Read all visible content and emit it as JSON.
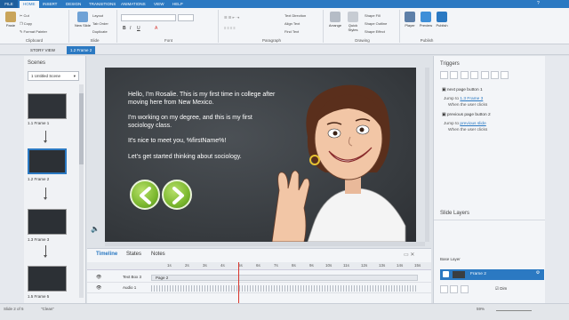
{
  "ribbon_tabs": [
    "FILE",
    "HOME",
    "INSERT",
    "DESIGN",
    "TRANSITIONS",
    "ANIMATIONS",
    "VIEW",
    "HELP"
  ],
  "ribbon": {
    "paste": "Paste",
    "cut": "Cut",
    "copy": "Copy",
    "format_painter": "Format Painter",
    "clipboard": "Clipboard",
    "new_slide": "New Slide",
    "layout": "Layout",
    "tab_order": "Tab Order",
    "duplicate": "Duplicate",
    "slide": "Slide",
    "font": "Font",
    "text_direction": "Text Direction",
    "align_text": "Align Text",
    "find_text": "Find Text",
    "paragraph": "Paragraph",
    "arrange": "Arrange",
    "quick_styles": "Quick Styles",
    "shape_fill": "Shape Fill",
    "shape_outline": "Shape Outline",
    "shape_effect": "Shape Effect",
    "drawing": "Drawing",
    "player": "Player",
    "preview": "Preview",
    "publish": "Publish",
    "publish_group": "Publish"
  },
  "subtabs": [
    "STORY VIEW",
    "1.2 Frame 2"
  ],
  "scenes": {
    "title": "Scenes",
    "selector": "1 Untitled Scene",
    "frames": [
      "1.1 Frame 1",
      "1.2 Frame 2",
      "1.3 Frame 3",
      "1.4 Frame 4",
      "1.5 Frame 5"
    ]
  },
  "slide": {
    "line1": "Hello, I'm Rosalie. This is my first time in college after moving here from New Mexico.",
    "line2": "I'm working on my degree, and this is my first sociology class.",
    "line3": "It's nice to meet you, %firstName%!",
    "line4": "Let's get started thinking about sociology."
  },
  "timeline": {
    "tabs": [
      "Timeline",
      "States",
      "Notes"
    ],
    "ticks": [
      "1s",
      "2s",
      "3s",
      "4s",
      "5s",
      "6s",
      "7s",
      "8s",
      "9s",
      "10s",
      "11s",
      "12s",
      "13s",
      "14s",
      "15s"
    ],
    "rows": [
      {
        "name": "Text Box 3",
        "bar": "Page 2"
      },
      {
        "name": "Audio 1",
        "bar": ""
      }
    ]
  },
  "triggers": {
    "title": "Triggers",
    "items": [
      {
        "title": "next page button 1",
        "jump_prefix": "Jump to",
        "target": "1.3 Frame 3",
        "when": "When the user clicks"
      },
      {
        "title": "previous page button 2",
        "jump_prefix": "Jump to",
        "target": "previous slide",
        "when": "When the user clicks"
      }
    ]
  },
  "slide_layers": {
    "title": "Slide Layers",
    "base_layer": "Base Layer",
    "layer_name": "Frame 2",
    "dim_label": "Dim"
  },
  "status": {
    "slide_info": "Slide 2 of 5",
    "theme": "\"Clean\"",
    "zoom": "59%"
  }
}
